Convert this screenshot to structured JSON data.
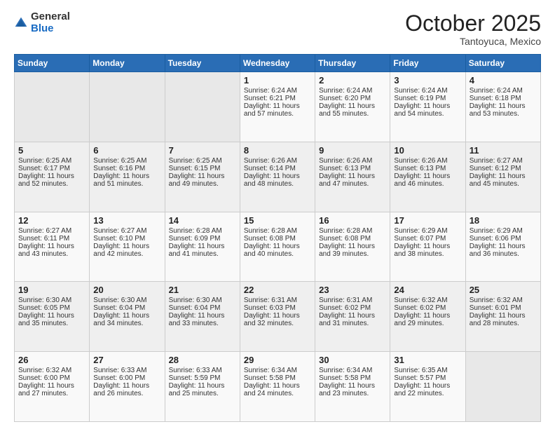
{
  "header": {
    "logo_line1": "General",
    "logo_line2": "Blue",
    "month": "October 2025",
    "location": "Tantoyuca, Mexico"
  },
  "days_of_week": [
    "Sunday",
    "Monday",
    "Tuesday",
    "Wednesday",
    "Thursday",
    "Friday",
    "Saturday"
  ],
  "weeks": [
    [
      {
        "day": "",
        "content": ""
      },
      {
        "day": "",
        "content": ""
      },
      {
        "day": "",
        "content": ""
      },
      {
        "day": "1",
        "content": "Sunrise: 6:24 AM\nSunset: 6:21 PM\nDaylight: 11 hours\nand 57 minutes."
      },
      {
        "day": "2",
        "content": "Sunrise: 6:24 AM\nSunset: 6:20 PM\nDaylight: 11 hours\nand 55 minutes."
      },
      {
        "day": "3",
        "content": "Sunrise: 6:24 AM\nSunset: 6:19 PM\nDaylight: 11 hours\nand 54 minutes."
      },
      {
        "day": "4",
        "content": "Sunrise: 6:24 AM\nSunset: 6:18 PM\nDaylight: 11 hours\nand 53 minutes."
      }
    ],
    [
      {
        "day": "5",
        "content": "Sunrise: 6:25 AM\nSunset: 6:17 PM\nDaylight: 11 hours\nand 52 minutes."
      },
      {
        "day": "6",
        "content": "Sunrise: 6:25 AM\nSunset: 6:16 PM\nDaylight: 11 hours\nand 51 minutes."
      },
      {
        "day": "7",
        "content": "Sunrise: 6:25 AM\nSunset: 6:15 PM\nDaylight: 11 hours\nand 49 minutes."
      },
      {
        "day": "8",
        "content": "Sunrise: 6:26 AM\nSunset: 6:14 PM\nDaylight: 11 hours\nand 48 minutes."
      },
      {
        "day": "9",
        "content": "Sunrise: 6:26 AM\nSunset: 6:13 PM\nDaylight: 11 hours\nand 47 minutes."
      },
      {
        "day": "10",
        "content": "Sunrise: 6:26 AM\nSunset: 6:13 PM\nDaylight: 11 hours\nand 46 minutes."
      },
      {
        "day": "11",
        "content": "Sunrise: 6:27 AM\nSunset: 6:12 PM\nDaylight: 11 hours\nand 45 minutes."
      }
    ],
    [
      {
        "day": "12",
        "content": "Sunrise: 6:27 AM\nSunset: 6:11 PM\nDaylight: 11 hours\nand 43 minutes."
      },
      {
        "day": "13",
        "content": "Sunrise: 6:27 AM\nSunset: 6:10 PM\nDaylight: 11 hours\nand 42 minutes."
      },
      {
        "day": "14",
        "content": "Sunrise: 6:28 AM\nSunset: 6:09 PM\nDaylight: 11 hours\nand 41 minutes."
      },
      {
        "day": "15",
        "content": "Sunrise: 6:28 AM\nSunset: 6:08 PM\nDaylight: 11 hours\nand 40 minutes."
      },
      {
        "day": "16",
        "content": "Sunrise: 6:28 AM\nSunset: 6:08 PM\nDaylight: 11 hours\nand 39 minutes."
      },
      {
        "day": "17",
        "content": "Sunrise: 6:29 AM\nSunset: 6:07 PM\nDaylight: 11 hours\nand 38 minutes."
      },
      {
        "day": "18",
        "content": "Sunrise: 6:29 AM\nSunset: 6:06 PM\nDaylight: 11 hours\nand 36 minutes."
      }
    ],
    [
      {
        "day": "19",
        "content": "Sunrise: 6:30 AM\nSunset: 6:05 PM\nDaylight: 11 hours\nand 35 minutes."
      },
      {
        "day": "20",
        "content": "Sunrise: 6:30 AM\nSunset: 6:04 PM\nDaylight: 11 hours\nand 34 minutes."
      },
      {
        "day": "21",
        "content": "Sunrise: 6:30 AM\nSunset: 6:04 PM\nDaylight: 11 hours\nand 33 minutes."
      },
      {
        "day": "22",
        "content": "Sunrise: 6:31 AM\nSunset: 6:03 PM\nDaylight: 11 hours\nand 32 minutes."
      },
      {
        "day": "23",
        "content": "Sunrise: 6:31 AM\nSunset: 6:02 PM\nDaylight: 11 hours\nand 31 minutes."
      },
      {
        "day": "24",
        "content": "Sunrise: 6:32 AM\nSunset: 6:02 PM\nDaylight: 11 hours\nand 29 minutes."
      },
      {
        "day": "25",
        "content": "Sunrise: 6:32 AM\nSunset: 6:01 PM\nDaylight: 11 hours\nand 28 minutes."
      }
    ],
    [
      {
        "day": "26",
        "content": "Sunrise: 6:32 AM\nSunset: 6:00 PM\nDaylight: 11 hours\nand 27 minutes."
      },
      {
        "day": "27",
        "content": "Sunrise: 6:33 AM\nSunset: 6:00 PM\nDaylight: 11 hours\nand 26 minutes."
      },
      {
        "day": "28",
        "content": "Sunrise: 6:33 AM\nSunset: 5:59 PM\nDaylight: 11 hours\nand 25 minutes."
      },
      {
        "day": "29",
        "content": "Sunrise: 6:34 AM\nSunset: 5:58 PM\nDaylight: 11 hours\nand 24 minutes."
      },
      {
        "day": "30",
        "content": "Sunrise: 6:34 AM\nSunset: 5:58 PM\nDaylight: 11 hours\nand 23 minutes."
      },
      {
        "day": "31",
        "content": "Sunrise: 6:35 AM\nSunset: 5:57 PM\nDaylight: 11 hours\nand 22 minutes."
      },
      {
        "day": "",
        "content": ""
      }
    ]
  ]
}
